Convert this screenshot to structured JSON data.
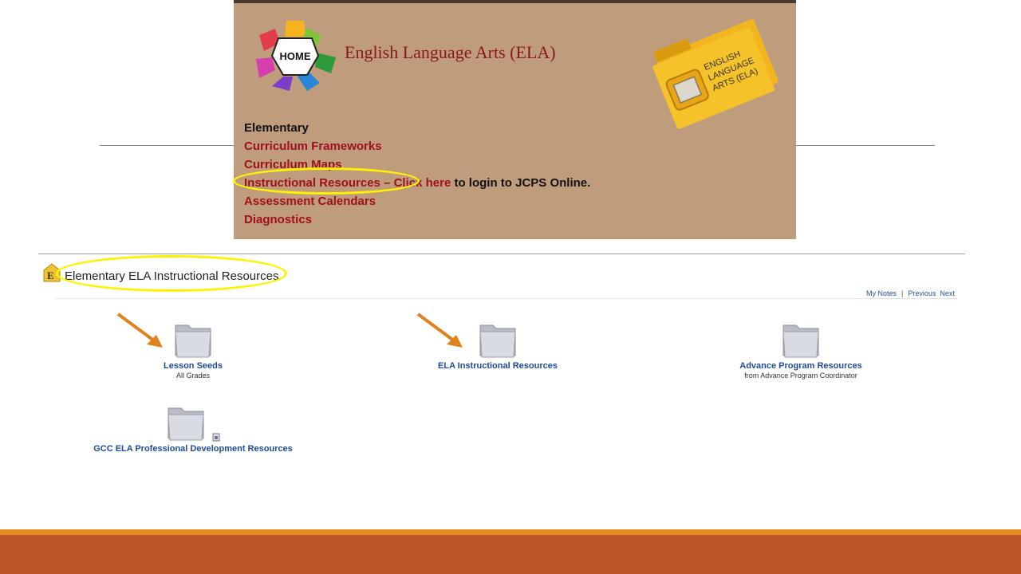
{
  "header_banner": {
    "home_label": "HOME",
    "title": "English Language Arts (ELA)",
    "logo_text": [
      "ENGLISH",
      "LANGUAGE",
      "ARTS (ELA)"
    ],
    "links": {
      "elementary": "Elementary",
      "curriculum_frameworks": "Curriculum Frameworks",
      "curriculum_maps": "Curriculum Maps",
      "instructional_resources": "Instructional Resources",
      "dash": " – ",
      "click_here": "Click here",
      "login_text": " to login to JCPS Online.",
      "assessment_calendars": "Assessment Calendars",
      "diagnostics": "Diagnostics"
    }
  },
  "content_page": {
    "title": "Elementary ELA Instructional Resources",
    "nav": {
      "my_notes": "My Notes",
      "sep": "|",
      "previous": "Previous",
      "next": "Next"
    },
    "folders": [
      {
        "label": "Lesson Seeds",
        "sublabel": "All Grades"
      },
      {
        "label": "ELA Instructional Resources",
        "sublabel": ""
      },
      {
        "label": "Advance Program Resources",
        "sublabel": "from Advance Program Coordinator"
      },
      {
        "label": "GCC ELA Professional Development Resources",
        "sublabel": ""
      }
    ]
  },
  "colors": {
    "panel_bg": "#bf9c7b",
    "link_red": "#a0101a",
    "highlight": "#fff200",
    "arrow": "#e0821e",
    "folder_link_blue": "#1f4b97",
    "bottom_band": "#be5627",
    "bottom_stripe": "#e38b1f"
  }
}
